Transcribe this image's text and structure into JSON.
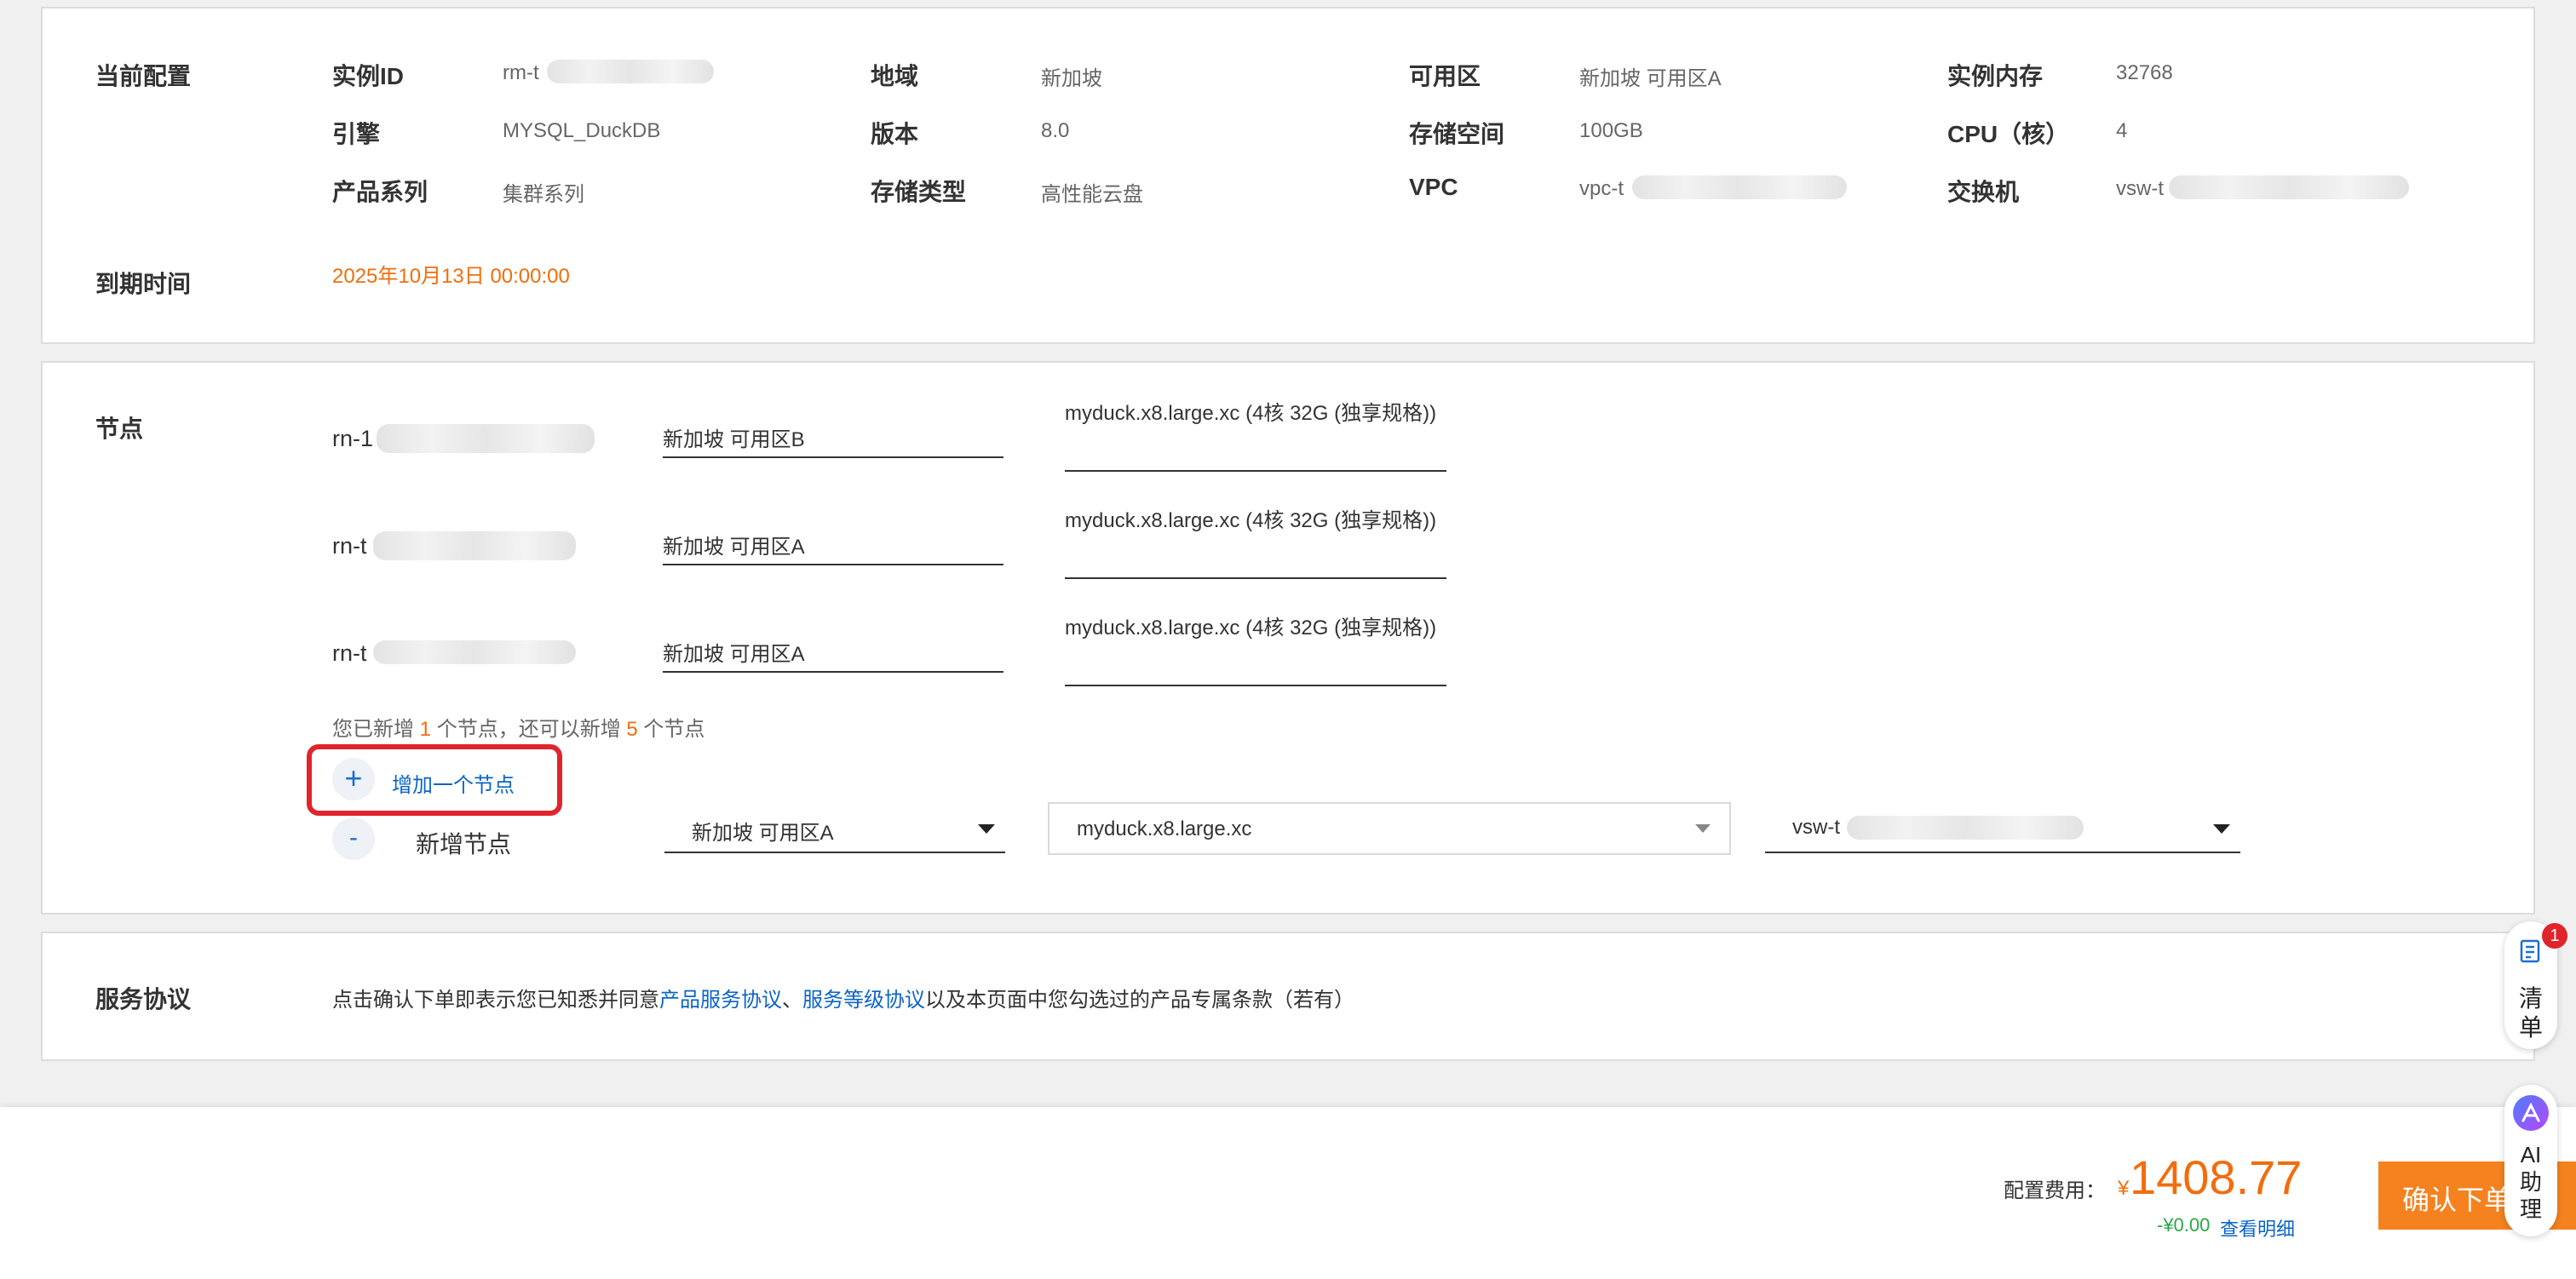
{
  "current_config": {
    "section_title": "当前配置",
    "fields": {
      "instance_id": {
        "label": "实例ID",
        "value": "rm-t"
      },
      "region": {
        "label": "地域",
        "value": "新加坡"
      },
      "zone": {
        "label": "可用区",
        "value": "新加坡 可用区A"
      },
      "memory": {
        "label": "实例内存",
        "value": "32768"
      },
      "engine": {
        "label": "引擎",
        "value": "MYSQL_DuckDB"
      },
      "version": {
        "label": "版本",
        "value": "8.0"
      },
      "storage": {
        "label": "存储空间",
        "value": "100GB"
      },
      "cpu": {
        "label": "CPU（核）",
        "value": "4"
      },
      "series": {
        "label": "产品系列",
        "value": "集群系列"
      },
      "storage_type": {
        "label": "存储类型",
        "value": "高性能云盘"
      },
      "vpc": {
        "label": "VPC",
        "value": "vpc-t"
      },
      "vswitch": {
        "label": "交换机",
        "value": "vsw-t"
      }
    },
    "expire": {
      "label": "到期时间",
      "value": "2025年10月13日 00:00:00"
    }
  },
  "nodes": {
    "section_title": "节点",
    "items": [
      {
        "id": "rn-1",
        "zone": "新加坡 可用区B",
        "spec": "myduck.x8.large.xc (4核 32G (独享规格))"
      },
      {
        "id": "rn-t",
        "zone": "新加坡 可用区A",
        "spec": "myduck.x8.large.xc (4核 32G (独享规格))"
      },
      {
        "id": "rn-t",
        "zone": "新加坡 可用区A",
        "spec": "myduck.x8.large.xc (4核 32G (独享规格))"
      }
    ],
    "notice": {
      "prefix": "您已新增 ",
      "added": "1",
      "middle": " 个节点，还可以新增 ",
      "remaining": "5",
      "suffix": " 个节点"
    },
    "add_node_label": "增加一个节点",
    "add_icon": "+",
    "remove_icon": "-",
    "new_node": {
      "label": "新增节点",
      "zone": "新加坡 可用区A",
      "spec": "myduck.x8.large.xc",
      "vswitch": "vsw-t"
    }
  },
  "agreement": {
    "section_title": "服务协议",
    "text_prefix": "点击确认下单即表示您已知悉并同意",
    "link1": "产品服务协议",
    "separator": "、",
    "link2": "服务等级协议",
    "text_suffix": "以及本页面中您勾选过的产品专属条款（若有）"
  },
  "footer": {
    "fee_label": "配置费用：",
    "currency": "¥",
    "price": "1408.77",
    "discount": "-¥0.00",
    "detail_link": "查看明细",
    "confirm_button": "确认下单"
  },
  "floating": {
    "cart_label": "清单",
    "cart_badge": "1",
    "ai_label": "AI助理"
  },
  "colors": {
    "accent": "#f26d0c",
    "link": "#0a64c8",
    "discount": "#28a745",
    "highlight": "#e0242b"
  }
}
